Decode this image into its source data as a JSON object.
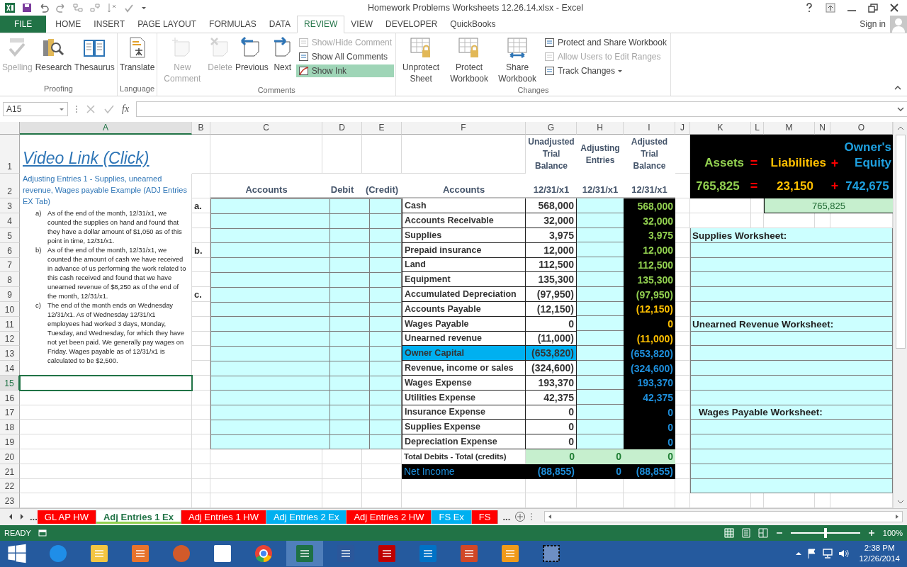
{
  "window": {
    "title": "Homework Problems Worksheets 12.26.14.xlsx - Excel",
    "sign_in": "Sign in"
  },
  "ribbon_tabs": [
    {
      "label": "FILE",
      "kind": "file",
      "selected": false
    },
    {
      "label": "HOME",
      "kind": "tab",
      "selected": false
    },
    {
      "label": "INSERT",
      "kind": "tab",
      "selected": false
    },
    {
      "label": "PAGE LAYOUT",
      "kind": "tab",
      "selected": false
    },
    {
      "label": "FORMULAS",
      "kind": "tab",
      "selected": false
    },
    {
      "label": "DATA",
      "kind": "tab",
      "selected": false
    },
    {
      "label": "REVIEW",
      "kind": "tab",
      "selected": true
    },
    {
      "label": "VIEW",
      "kind": "tab",
      "selected": false
    },
    {
      "label": "DEVELOPER",
      "kind": "tab",
      "selected": false
    },
    {
      "label": "QuickBooks",
      "kind": "tab",
      "selected": false
    }
  ],
  "ribbon": {
    "groups": [
      {
        "label": "Proofing",
        "large": [
          {
            "label": "Spelling",
            "disabled": true
          },
          {
            "label": "Research",
            "disabled": false
          },
          {
            "label": "Thesaurus",
            "disabled": false
          }
        ]
      },
      {
        "label": "Language",
        "large": [
          {
            "label": "Translate",
            "disabled": false
          }
        ]
      },
      {
        "label": "Comments",
        "large": [
          {
            "label": "New Comment",
            "disabled": true
          },
          {
            "label": "Delete",
            "disabled": true
          },
          {
            "label": "Previous",
            "disabled": false
          },
          {
            "label": "Next",
            "disabled": false
          }
        ],
        "small": [
          {
            "label": "Show/Hide Comment",
            "disabled": true,
            "on": false,
            "dropdown": false
          },
          {
            "label": "Show All Comments",
            "disabled": false,
            "on": false,
            "dropdown": false
          },
          {
            "label": "Show Ink",
            "disabled": false,
            "on": true,
            "dropdown": false
          }
        ]
      },
      {
        "label": "Changes",
        "large": [
          {
            "label": "Unprotect Sheet",
            "disabled": false
          },
          {
            "label": "Protect Workbook",
            "disabled": false
          },
          {
            "label": "Share Workbook",
            "disabled": false
          }
        ],
        "small": [
          {
            "label": "Protect and Share Workbook",
            "disabled": false,
            "on": false,
            "dropdown": false
          },
          {
            "label": "Allow Users to Edit Ranges",
            "disabled": true,
            "on": false,
            "dropdown": false
          },
          {
            "label": "Track Changes",
            "disabled": false,
            "on": false,
            "dropdown": true
          }
        ]
      }
    ]
  },
  "formula_bar": {
    "name_box": "A15",
    "fx": "fx"
  },
  "sheet": {
    "columns": [
      {
        "label": "A",
        "selected": true
      },
      {
        "label": "B",
        "selected": false
      },
      {
        "label": "C",
        "selected": false
      },
      {
        "label": "D",
        "selected": false
      },
      {
        "label": "E",
        "selected": false
      },
      {
        "label": "F",
        "selected": false
      },
      {
        "label": "G",
        "selected": false
      },
      {
        "label": "H",
        "selected": false
      },
      {
        "label": "I",
        "selected": false
      },
      {
        "label": "J",
        "selected": false
      },
      {
        "label": "K",
        "selected": false
      },
      {
        "label": "L",
        "selected": false
      },
      {
        "label": "M",
        "selected": false
      },
      {
        "label": "N",
        "selected": false
      },
      {
        "label": "O",
        "selected": false
      }
    ],
    "rows": [
      {
        "label": "1",
        "selected": false
      },
      {
        "label": "2",
        "selected": false
      },
      {
        "label": "3",
        "selected": false
      },
      {
        "label": "4",
        "selected": false
      },
      {
        "label": "5",
        "selected": false
      },
      {
        "label": "6",
        "selected": false
      },
      {
        "label": "7",
        "selected": false
      },
      {
        "label": "8",
        "selected": false
      },
      {
        "label": "9",
        "selected": false
      },
      {
        "label": "10",
        "selected": false
      },
      {
        "label": "11",
        "selected": false
      },
      {
        "label": "12",
        "selected": false
      },
      {
        "label": "13",
        "selected": false
      },
      {
        "label": "14",
        "selected": false
      },
      {
        "label": "15",
        "selected": true
      },
      {
        "label": "16",
        "selected": false
      },
      {
        "label": "17",
        "selected": false
      },
      {
        "label": "18",
        "selected": false
      },
      {
        "label": "19",
        "selected": false
      },
      {
        "label": "20",
        "selected": false
      },
      {
        "label": "21",
        "selected": false
      },
      {
        "label": "22",
        "selected": false
      },
      {
        "label": "23",
        "selected": false
      }
    ],
    "video_link": "Video Link (Click)",
    "intro": "Adjusting Entries 1 - Supplies, unearned revenue, Wages payable Example (ADJ Entries EX Tab)",
    "problems": [
      {
        "marker": "a)",
        "text": "As of the end of the month, 12/31/x1, we counted the supplies on hand and found that they have a dollar amount of $1,050 as of this point in time, 12/31/x1."
      },
      {
        "marker": "b)",
        "text": "As of the end of the month, 12/31/x1, we counted the amount of cash we have received in advance of us performing the work related to this cash received and found that we have unearned revenue of $8,250 as of the end of the month, 12/31/x1."
      },
      {
        "marker": "c)",
        "text": "The end of the month ends on Wednesday 12/31/x1. As of Wednesday 12/31/x1 employees had worked 3 days, Monday, Tuesday, and Wednesday, for which they have not yet been paid. We generally pay wages on Friday. Wages payable as of 12/31/x1 is calculated to be $2,500."
      }
    ],
    "problem_labels": [
      "a.",
      "b.",
      "c."
    ],
    "journal_headers": [
      "Accounts",
      "Debit",
      "(Credit)"
    ],
    "tb_accounts_header": "Accounts",
    "tb_columns": [
      {
        "title": "Unadjusted Trial Balance",
        "date": "12/31/x1"
      },
      {
        "title": "Adjusting Entries",
        "date": "12/31/x1"
      },
      {
        "title": "Adjusted Trial Balance",
        "date": "12/31/x1"
      }
    ],
    "accounts": [
      {
        "name": "Cash",
        "unadjusted": "568,000",
        "adjusted": "568,000",
        "color": "#92d050",
        "highlighted": false
      },
      {
        "name": "Accounts Receivable",
        "unadjusted": "32,000",
        "adjusted": "32,000",
        "color": "#92d050",
        "highlighted": false
      },
      {
        "name": "Supplies",
        "unadjusted": "3,975",
        "adjusted": "3,975",
        "color": "#92d050",
        "highlighted": false
      },
      {
        "name": "Prepaid insurance",
        "unadjusted": "12,000",
        "adjusted": "12,000",
        "color": "#92d050",
        "highlighted": false
      },
      {
        "name": "Land",
        "unadjusted": "112,500",
        "adjusted": "112,500",
        "color": "#92d050",
        "highlighted": false
      },
      {
        "name": "Equipment",
        "unadjusted": "135,300",
        "adjusted": "135,300",
        "color": "#92d050",
        "highlighted": false
      },
      {
        "name": "Accumulated Depreciation",
        "unadjusted": "(97,950)",
        "adjusted": "(97,950)",
        "color": "#92d050",
        "highlighted": false
      },
      {
        "name": "Accounts Payable",
        "unadjusted": "(12,150)",
        "adjusted": "(12,150)",
        "color": "#ffc000",
        "highlighted": false
      },
      {
        "name": "Wages Payable",
        "unadjusted": "0",
        "adjusted": "0",
        "color": "#ffc000",
        "highlighted": false
      },
      {
        "name": "Unearned revenue",
        "unadjusted": "(11,000)",
        "adjusted": "(11,000)",
        "color": "#ffc000",
        "highlighted": false
      },
      {
        "name": "Owner Capital",
        "unadjusted": "(653,820)",
        "adjusted": "(653,820)",
        "color": "#1e8fdc",
        "highlighted": true
      },
      {
        "name": "Revenue, income or sales",
        "unadjusted": "(324,600)",
        "adjusted": "(324,600)",
        "color": "#1e8fdc",
        "highlighted": false
      },
      {
        "name": "Wages Expense",
        "unadjusted": "193,370",
        "adjusted": "193,370",
        "color": "#1e8fdc",
        "highlighted": false
      },
      {
        "name": "Utilities Expense",
        "unadjusted": "42,375",
        "adjusted": "42,375",
        "color": "#1e8fdc",
        "highlighted": false
      },
      {
        "name": "Insurance Expense",
        "unadjusted": "0",
        "adjusted": "0",
        "color": "#1e8fdc",
        "highlighted": false
      },
      {
        "name": "Supplies Expense",
        "unadjusted": "0",
        "adjusted": "0",
        "color": "#1e8fdc",
        "highlighted": false
      },
      {
        "name": "Depreciation Expense",
        "unadjusted": "0",
        "adjusted": "0",
        "color": "#1e8fdc",
        "highlighted": false
      }
    ],
    "totals": {
      "label": "Total Debits - Total (credits)",
      "values": [
        "0",
        "0",
        "0"
      ]
    },
    "net_income": {
      "label": "Net Income",
      "values": [
        "(88,855)",
        "0",
        "(88,855)"
      ]
    },
    "equation": {
      "terms": [
        {
          "label": "Assets",
          "value": "765,825",
          "color": "#92d050"
        },
        {
          "label": "Liabilities",
          "value": "23,150",
          "color": "#ffc000"
        },
        {
          "label": "Owner's Equity",
          "value": "742,675",
          "color": "#1ea0e0"
        }
      ],
      "operators": [
        {
          "label_row": "=",
          "value_row": "="
        },
        {
          "label_row": "+",
          "value_row": "+"
        }
      ],
      "check": "765,825"
    },
    "worksheets": [
      "Supplies Worksheet:",
      "Unearned Revenue Worksheet:",
      "Wages Payable Worksheet:"
    ]
  },
  "sheet_nav": {
    "before": "...",
    "after": "..."
  },
  "sheet_tabs": [
    {
      "label": "GL AP HW",
      "color": "#ff0000",
      "selected": false
    },
    {
      "label": "Adj Entries 1 Ex",
      "color": "#92d050",
      "selected": true
    },
    {
      "label": "Adj Entries 1 HW",
      "color": "#ff0000",
      "selected": false
    },
    {
      "label": "Adj Entries 2 Ex",
      "color": "#00b0f0",
      "selected": false
    },
    {
      "label": "Adj Entries 2 HW",
      "color": "#ff0000",
      "selected": false
    },
    {
      "label": "FS Ex",
      "color": "#00b0f0",
      "selected": false
    },
    {
      "label": "FS",
      "color": "#ff0000",
      "selected": false
    }
  ],
  "status": {
    "mode": "READY",
    "zoom": "100%",
    "zoom_level": {
      "level": 0.5
    }
  },
  "taskbar": {
    "apps": [
      {
        "selected": false
      },
      {
        "selected": false
      },
      {
        "selected": false
      },
      {
        "selected": false
      },
      {
        "selected": false
      },
      {
        "selected": false
      },
      {
        "selected": true
      },
      {
        "selected": false
      },
      {
        "selected": false
      },
      {
        "selected": false
      },
      {
        "selected": false
      },
      {
        "selected": false
      },
      {
        "selected": false
      }
    ],
    "time": "2:38 PM",
    "date": "12/26/2014"
  }
}
